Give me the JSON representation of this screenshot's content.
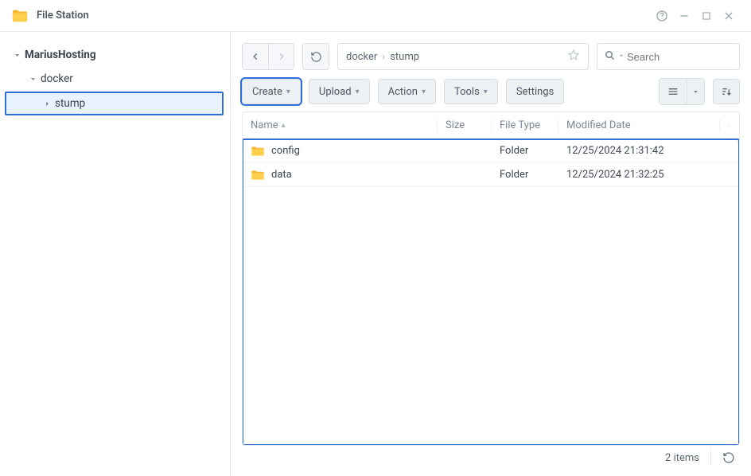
{
  "app": {
    "title": "File Station"
  },
  "sidebar": {
    "root": "MariusHosting",
    "node1": "docker",
    "node2": "stump"
  },
  "breadcrumb": {
    "p0": "docker",
    "p1": "stump"
  },
  "search": {
    "placeholder": "Search"
  },
  "toolbar": {
    "create": "Create",
    "upload": "Upload",
    "action": "Action",
    "tools": "Tools",
    "settings": "Settings"
  },
  "columns": {
    "name": "Name",
    "size": "Size",
    "type": "File Type",
    "modified": "Modified Date"
  },
  "rows": [
    {
      "name": "config",
      "size": "",
      "type": "Folder",
      "modified": "12/25/2024 21:31:42"
    },
    {
      "name": "data",
      "size": "",
      "type": "Folder",
      "modified": "12/25/2024 21:32:25"
    }
  ],
  "status": {
    "count": "2 items"
  }
}
